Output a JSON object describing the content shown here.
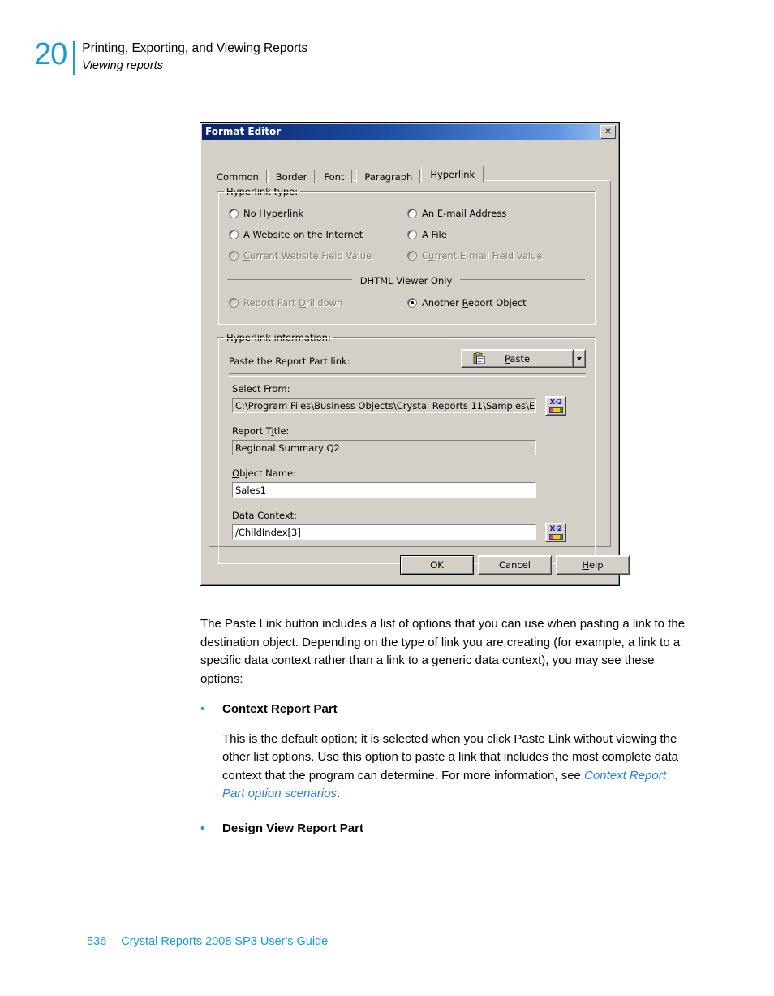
{
  "page_header": {
    "chapter_number": "20",
    "title": "Printing, Exporting, and Viewing Reports",
    "subtitle": "Viewing reports"
  },
  "dialog": {
    "title": "Format Editor",
    "close_label": "✕",
    "tabs": [
      {
        "label": "Common",
        "active": false
      },
      {
        "label": "Border",
        "active": false
      },
      {
        "label": "Font",
        "active": false
      },
      {
        "label": "Paragraph",
        "active": false
      },
      {
        "label": "Hyperlink",
        "active": true
      }
    ],
    "hyperlink_type": {
      "legend": "Hyperlink type:",
      "options": [
        {
          "label": "No Hyperlink",
          "checked": false,
          "disabled": false
        },
        {
          "label": "An E-mail Address",
          "checked": false,
          "disabled": false
        },
        {
          "label": "A Website on the Internet",
          "checked": false,
          "disabled": false
        },
        {
          "label": "A File",
          "checked": false,
          "disabled": false
        },
        {
          "label": "Current Website Field Value",
          "checked": false,
          "disabled": true
        },
        {
          "label": "Current E-mail Field Value",
          "checked": false,
          "disabled": true
        }
      ],
      "dhtml_caption": "DHTML Viewer Only",
      "dhtml_options": [
        {
          "label": "Report Part Drilldown",
          "checked": false,
          "disabled": true
        },
        {
          "label": "Another Report Object",
          "checked": true,
          "disabled": false
        }
      ]
    },
    "hyperlink_information": {
      "legend": "Hyperlink information:",
      "paste_prompt": "Paste the Report Part link:",
      "paste_button": "Paste",
      "paste_icon": "clipboard-icon",
      "dropdown_icon": "chevron-down-icon",
      "fields": [
        {
          "label": "Select From:",
          "value": "C:\\Program Files\\Business Objects\\Crystal Reports 11\\Samples\\En'",
          "readonly": true,
          "formula_button": true,
          "formula_icon": "x2-formula-icon"
        },
        {
          "label": "Report Title:",
          "value": "Regional Summary Q2",
          "readonly": true,
          "formula_button": false
        },
        {
          "label": "Object Name:",
          "value": "Sales1",
          "readonly": false,
          "formula_button": false
        },
        {
          "label": "Data Context:",
          "value": "/ChildIndex[3]",
          "readonly": false,
          "formula_button": true,
          "formula_icon": "x2-formula-icon"
        }
      ]
    },
    "buttons": [
      {
        "label": "OK",
        "default": true
      },
      {
        "label": "Cancel",
        "default": false
      },
      {
        "label": "Help",
        "default": false
      }
    ]
  },
  "content": {
    "paragraph_1": "The Paste Link button includes a list of options that you can use when pasting a link to the destination object. Depending on the type of link you are creating (for example, a link to a specific data context rather than a link to a generic data context), you may see these options:",
    "bullet_1_heading": "Context Report Part",
    "bullet_1_body_before": "This is the default option; it is selected when you click Paste Link without viewing the other list options. Use this option to paste a link that includes the most complete data context that the program can determine. For more information, see ",
    "bullet_1_link": "Context Report Part option scenarios",
    "bullet_1_body_after": ".",
    "bullet_2_heading": "Design View Report Part",
    "bullet_marker": "•"
  },
  "footer": {
    "page_number": "536",
    "guide_title": "Crystal Reports 2008 SP3 User's Guide"
  },
  "colors": {
    "accent_blue": "#1b9ad2",
    "link_blue": "#2a7fd4",
    "dialog_face": "#d4d0c8",
    "titlebar_blue": "#0a246a"
  }
}
